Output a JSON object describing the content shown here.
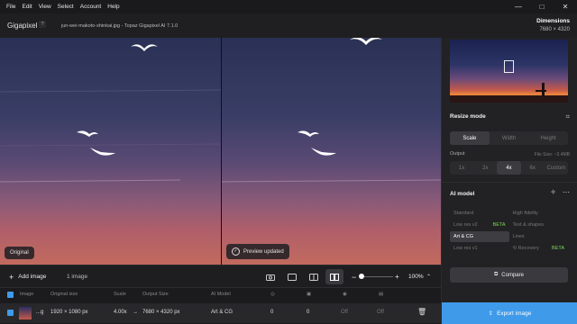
{
  "menu": [
    "File",
    "Edit",
    "View",
    "Select",
    "Account",
    "Help"
  ],
  "window_controls": [
    "—",
    "□",
    "✕"
  ],
  "app": {
    "name": "Gigapixel",
    "help_badge": "?",
    "filename": "jun-wei-makoto-shinkai.jpg - Topaz Gigapixel AI 7.1.0"
  },
  "dimensions": {
    "label": "Dimensions",
    "value": "7680 × 4320"
  },
  "preview": {
    "left_label": "Original",
    "right_label": "Preview updated"
  },
  "resize": {
    "title": "Resize mode",
    "tabs": [
      "Scale",
      "Width",
      "Height"
    ],
    "active_tab": "Scale"
  },
  "output": {
    "label": "Output",
    "filesize": "File Size: ~3.4MB",
    "options": [
      "1x",
      "2x",
      "4x",
      "6x",
      "Custom"
    ],
    "active": "4x"
  },
  "ai_model": {
    "title": "AI model",
    "rows": [
      [
        {
          "name": "Standard",
          "beta": ""
        },
        {
          "name": "High fidelity",
          "beta": ""
        }
      ],
      [
        {
          "name": "Low res v2",
          "beta": "BETA"
        },
        {
          "name": "Text & shapes",
          "beta": ""
        }
      ],
      [
        {
          "name": "Art & CG",
          "beta": "",
          "on": true
        },
        {
          "name": "Lines",
          "beta": ""
        }
      ],
      [
        {
          "name": "Low res v1",
          "beta": ""
        },
        {
          "name": "Recovery",
          "beta": "BETA"
        }
      ]
    ]
  },
  "compare_label": "Compare",
  "export_label": "Export image",
  "toolbar": {
    "add_image": "Add image",
    "count": "1 image",
    "zoom": "100%"
  },
  "table": {
    "headers": [
      "Image",
      "Original size",
      "Scale",
      "Output Size",
      "AI Model"
    ],
    "row": {
      "name": "...g",
      "original": "1920 × 1080 px",
      "scale": "4.00x",
      "arrow": "→",
      "output": "7680 × 4320 px",
      "model": "Art & CG",
      "v1": "0",
      "v2": "0",
      "v3": "Off",
      "v4": "Off"
    }
  },
  "colors": {
    "accent": "#3f9bea",
    "beta": "#7ed957"
  }
}
